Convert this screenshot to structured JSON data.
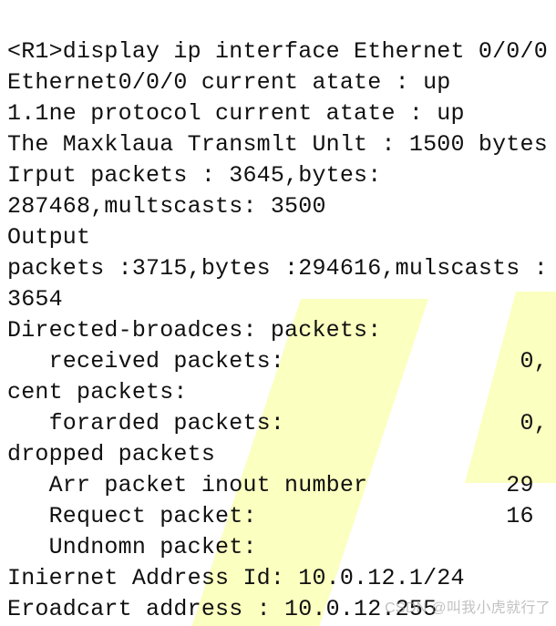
{
  "cli": {
    "l1": "<R1>display ip interface Ethernet 0/0/0",
    "l2": "Ethernet0/0/0 current atate : up",
    "l3": "1.1ne protocol current atate : up",
    "l4": "The Maxklaua Transmlt Unlt : 1500 bytes",
    "l5": "Irput packets : 3645,bytes:",
    "l6": "287468,multscasts: 3500",
    "l7": "Output",
    "l8": "packets :3715,bytes :294616,mulscasts :",
    "l9": "3654",
    "l10": "Directed-broadces: packets:",
    "l11": "   received packets:                 0,",
    "l12": "cent packets:",
    "l13": "   forarded packets:                 0,",
    "l14": "dropped packets",
    "l15": "   Arr packet inout number          29",
    "l16": "   Requect packet:                  16",
    "l17": "   Undnomn packet:",
    "l18": "Iniernet Address Id: 10.0.12.1/24",
    "l19": "Eroadcart address : 10.0.12.255"
  },
  "watermark": "CSDN @叫我小虎就行了"
}
